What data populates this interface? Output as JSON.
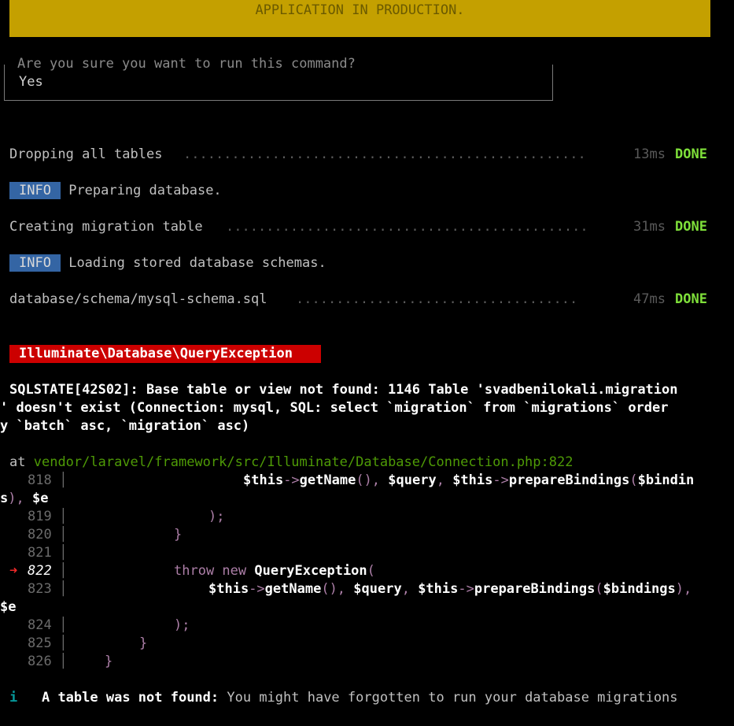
{
  "banner": "APPLICATION IN PRODUCTION.",
  "prompt": {
    "question": "Are you sure you want to run this command?",
    "answer": "Yes"
  },
  "tasks": [
    {
      "label": "Dropping all tables",
      "time": "13ms",
      "status": "DONE"
    },
    {
      "label": "Creating migration table",
      "time": "31ms",
      "status": "DONE"
    },
    {
      "label": "database/schema/mysql-schema.sql",
      "time": "47ms",
      "status": "DONE"
    }
  ],
  "infos": [
    {
      "badge": "INFO",
      "text": "Preparing database."
    },
    {
      "badge": "INFO",
      "text": "Loading stored database schemas."
    }
  ],
  "exception": {
    "class": "Illuminate\\Database\\QueryException",
    "message_lines": [
      "SQLSTATE[42S02]: Base table or view not found: 1146 Table 'svadbenilokali.migration",
      "' doesn't exist (Connection: mysql, SQL: select `migration` from `migrations` order",
      "y `batch` asc, `migration` asc)"
    ],
    "at_label": "at",
    "file": "vendor/laravel/framework/src/Illuminate/Database/Connection.php",
    "line": ":822"
  },
  "code": {
    "l818": "818",
    "l819": "819",
    "l820": "820",
    "l821": "821",
    "l822": "822",
    "l823": "823",
    "l824": "824",
    "l825": "825",
    "l826": "826",
    "arrow": "➜"
  },
  "hint": {
    "icon": "i",
    "bold": "A table was not found:",
    "text": " You might have forgotten to run your database migrations"
  },
  "colors": {
    "banner": "#c4a000",
    "info": "#3465a4",
    "exception": "#cc0000",
    "done": "#7fe03a"
  }
}
